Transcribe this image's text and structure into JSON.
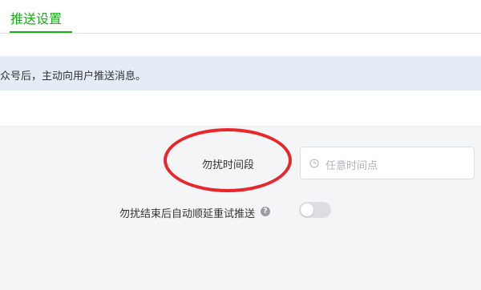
{
  "tabs": [
    {
      "label": "推送设置",
      "active": true
    }
  ],
  "notice": {
    "text": "众号后，主动向用户推送消息。"
  },
  "settings": {
    "quiet_period": {
      "label": "勿扰时间段",
      "placeholder": "任意时间点"
    },
    "auto_retry": {
      "label": "勿扰结束后自动顺延重试推送",
      "help": "?",
      "enabled": false
    }
  },
  "icons": {
    "clock": "clock-icon",
    "help": "question-circle-icon"
  },
  "colors": {
    "accent": "#1aad19",
    "annotation": "#e8262b",
    "notice_bg": "#e4ecf6",
    "panel_bg": "#f4f5f7"
  }
}
